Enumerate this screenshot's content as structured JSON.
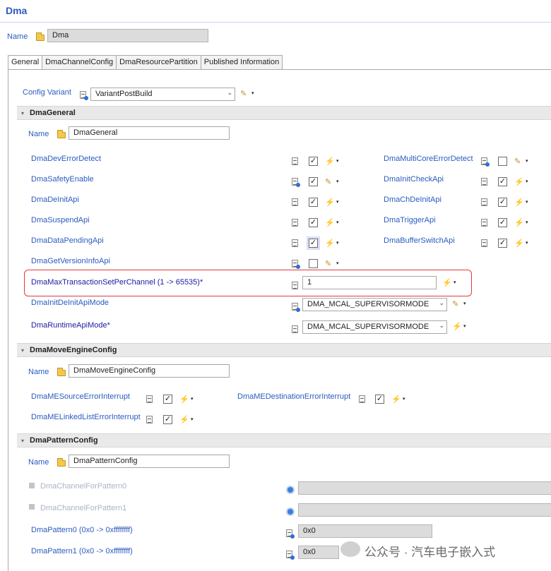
{
  "page": {
    "title": "Dma",
    "name_label": "Name",
    "name_value": "Dma"
  },
  "tabs": [
    "General",
    "DmaChannelConfig",
    "DmaResourcePartition",
    "Published Information"
  ],
  "config_variant": {
    "label": "Config Variant",
    "value": "VariantPostBuild"
  },
  "dma_general": {
    "header": "DmaGeneral",
    "name_label": "Name",
    "name_value": "DmaGeneral",
    "left_params": [
      {
        "label": "DmaDevErrorDetect",
        "checked": true
      },
      {
        "label": "DmaSafetyEnable",
        "checked": true
      },
      {
        "label": "DmaDeInitApi",
        "checked": true
      },
      {
        "label": "DmaSuspendApi",
        "checked": true
      },
      {
        "label": "DmaDataPendingApi",
        "checked": true
      },
      {
        "label": "DmaGetVersionInfoApi",
        "checked": false
      }
    ],
    "right_params": [
      {
        "label": "DmaMultiCoreErrorDetect",
        "checked": false
      },
      {
        "label": "DmaInitCheckApi",
        "checked": true
      },
      {
        "label": "DmaChDeInitApi",
        "checked": true
      },
      {
        "label": "DmaTriggerApi",
        "checked": true
      },
      {
        "label": "DmaBufferSwitchApi",
        "checked": true
      }
    ],
    "max_transaction": {
      "label": "DmaMaxTransactionSetPerChannel (1 -> 65535)*",
      "value": "1"
    },
    "init_deinit_mode": {
      "label": "DmaInitDeInitApiMode",
      "value": "DMA_MCAL_SUPERVISORMODE"
    },
    "runtime_mode": {
      "label": "DmaRuntimeApiMode*",
      "value": "DMA_MCAL_SUPERVISORMODE"
    }
  },
  "dma_move_engine": {
    "header": "DmaMoveEngineConfig",
    "name_label": "Name",
    "name_value": "DmaMoveEngineConfig",
    "source_error": "DmaMESourceErrorInterrupt",
    "destination_error": "DmaMEDestinationErrorInterrupt",
    "linked_list_error": "DmaMELinkedListErrorInterrupt"
  },
  "dma_pattern": {
    "header": "DmaPatternConfig",
    "name_label": "Name",
    "name_value": "DmaPatternConfig",
    "channel_pattern0": "DmaChannelForPattern0",
    "channel_pattern1": "DmaChannelForPattern1",
    "pattern0": {
      "label": "DmaPattern0 (0x0 -> 0xffffffff)",
      "value": "0x0"
    },
    "pattern1": {
      "label": "DmaPattern1 (0x0 -> 0xffffffff)",
      "value": "0x0"
    }
  },
  "watermark": "公众号 · 汽车电子嵌入式",
  "icons": {
    "check": "✓",
    "caret": "▾",
    "combo": "⌄",
    "pencil": "✎",
    "wand": "⚡",
    "collapse": "▾"
  }
}
